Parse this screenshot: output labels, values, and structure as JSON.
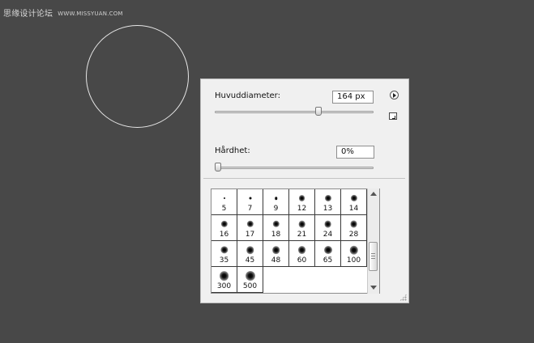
{
  "watermark": {
    "text": "思缘设计论坛",
    "site": "WWW.MISSYUAN.COM"
  },
  "panel": {
    "main_diameter_label": "Huvuddiameter:",
    "main_diameter_value": "164 px",
    "main_diameter_slider_fraction": 0.66,
    "hardness_label": "Hårdhet:",
    "hardness_value": "0%",
    "hardness_slider_fraction": 0.0,
    "menu_icon": "circle-arrow-right-icon",
    "new_preset_icon": "new-preset-icon"
  },
  "brush_presets": [
    {
      "size": "5",
      "hard": true
    },
    {
      "size": "7",
      "hard": true
    },
    {
      "size": "9",
      "hard": true
    },
    {
      "size": "12",
      "hard": false
    },
    {
      "size": "13",
      "hard": false
    },
    {
      "size": "14",
      "hard": false
    },
    {
      "size": "16",
      "hard": false
    },
    {
      "size": "17",
      "hard": false
    },
    {
      "size": "18",
      "hard": false
    },
    {
      "size": "21",
      "hard": false
    },
    {
      "size": "24",
      "hard": false
    },
    {
      "size": "28",
      "hard": false
    },
    {
      "size": "35",
      "hard": false
    },
    {
      "size": "45",
      "hard": false
    },
    {
      "size": "48",
      "hard": false
    },
    {
      "size": "60",
      "hard": false
    },
    {
      "size": "65",
      "hard": false
    },
    {
      "size": "100",
      "hard": false
    },
    {
      "size": "300",
      "hard": false
    },
    {
      "size": "500",
      "hard": false
    }
  ],
  "colors": {
    "canvas": "#484848",
    "panel": "#f0f0f0",
    "cursor": "#e6e6e6"
  }
}
